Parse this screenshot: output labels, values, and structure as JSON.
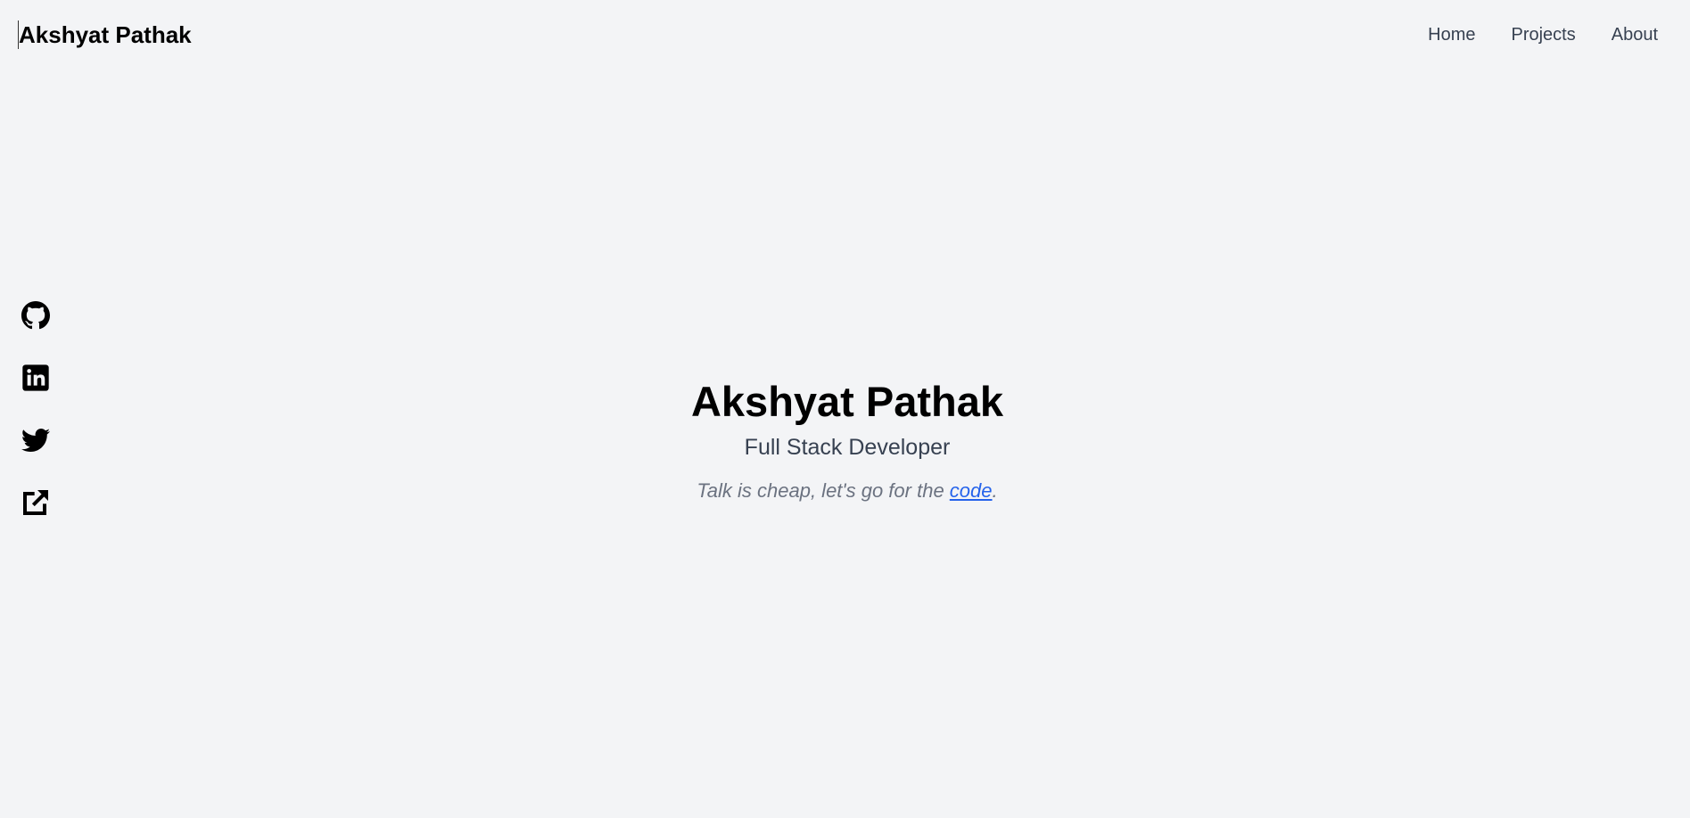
{
  "header": {
    "brand": "Akshyat Pathak",
    "nav": [
      {
        "label": "Home"
      },
      {
        "label": "Projects"
      },
      {
        "label": "About"
      }
    ]
  },
  "social": [
    {
      "icon": "github-icon"
    },
    {
      "icon": "linkedin-icon"
    },
    {
      "icon": "twitter-icon"
    },
    {
      "icon": "external-link-icon"
    }
  ],
  "hero": {
    "name": "Akshyat Pathak",
    "role": "Full Stack Developer",
    "quote_prefix": "Talk is cheap, let's go for the ",
    "quote_link": "code",
    "quote_suffix": "."
  },
  "colors": {
    "background": "#f3f4f6",
    "link": "#2563eb",
    "muted": "#6b7280",
    "nav": "#374151"
  }
}
